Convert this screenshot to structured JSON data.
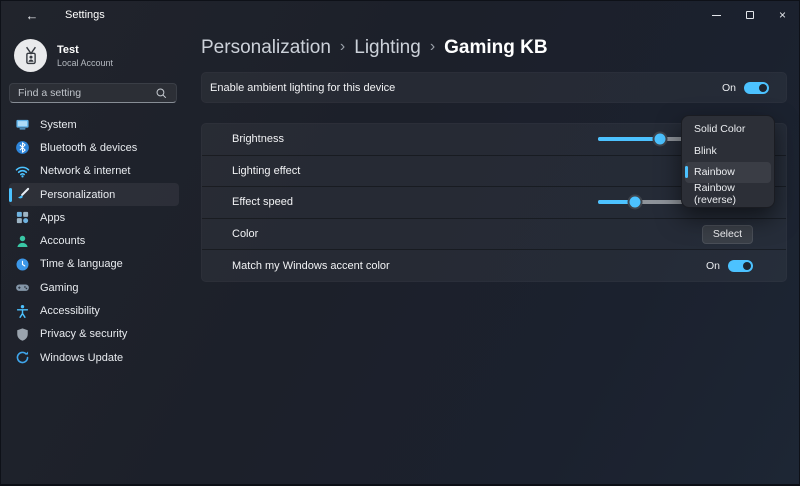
{
  "colors": {
    "accent": "#4cc2ff"
  },
  "titlebar": {
    "title": "Settings",
    "back_glyph": "←",
    "close_glyph": "×"
  },
  "account": {
    "name": "Test",
    "type": "Local Account"
  },
  "search": {
    "placeholder": "Find a setting"
  },
  "sidebar": {
    "items": [
      {
        "label": "System"
      },
      {
        "label": "Bluetooth & devices"
      },
      {
        "label": "Network & internet"
      },
      {
        "label": "Personalization",
        "selected": true
      },
      {
        "label": "Apps"
      },
      {
        "label": "Accounts"
      },
      {
        "label": "Time & language"
      },
      {
        "label": "Gaming"
      },
      {
        "label": "Accessibility"
      },
      {
        "label": "Privacy & security"
      },
      {
        "label": "Windows Update"
      }
    ]
  },
  "breadcrumb": {
    "separator": "›",
    "items": [
      "Personalization",
      "Lighting",
      "Gaming KB"
    ]
  },
  "content": {
    "enable_row": {
      "label": "Enable ambient lighting for this device",
      "state_label": "On"
    },
    "rows": [
      {
        "label": "Brightness",
        "control": "slider",
        "value_pct": 40
      },
      {
        "label": "Lighting effect",
        "control": "dropdown",
        "selected_value": "Rainbow"
      },
      {
        "label": "Effect speed",
        "control": "slider",
        "value_pct": 24
      },
      {
        "label": "Color",
        "control": "button",
        "button_label": "Select"
      },
      {
        "label": "Match my Windows accent color",
        "control": "toggle",
        "state_label": "On"
      }
    ],
    "flyout": {
      "items": [
        "Solid Color",
        "Blink",
        "Rainbow",
        "Rainbow (reverse)"
      ],
      "selected": "Rainbow",
      "selected_index": 2
    }
  }
}
